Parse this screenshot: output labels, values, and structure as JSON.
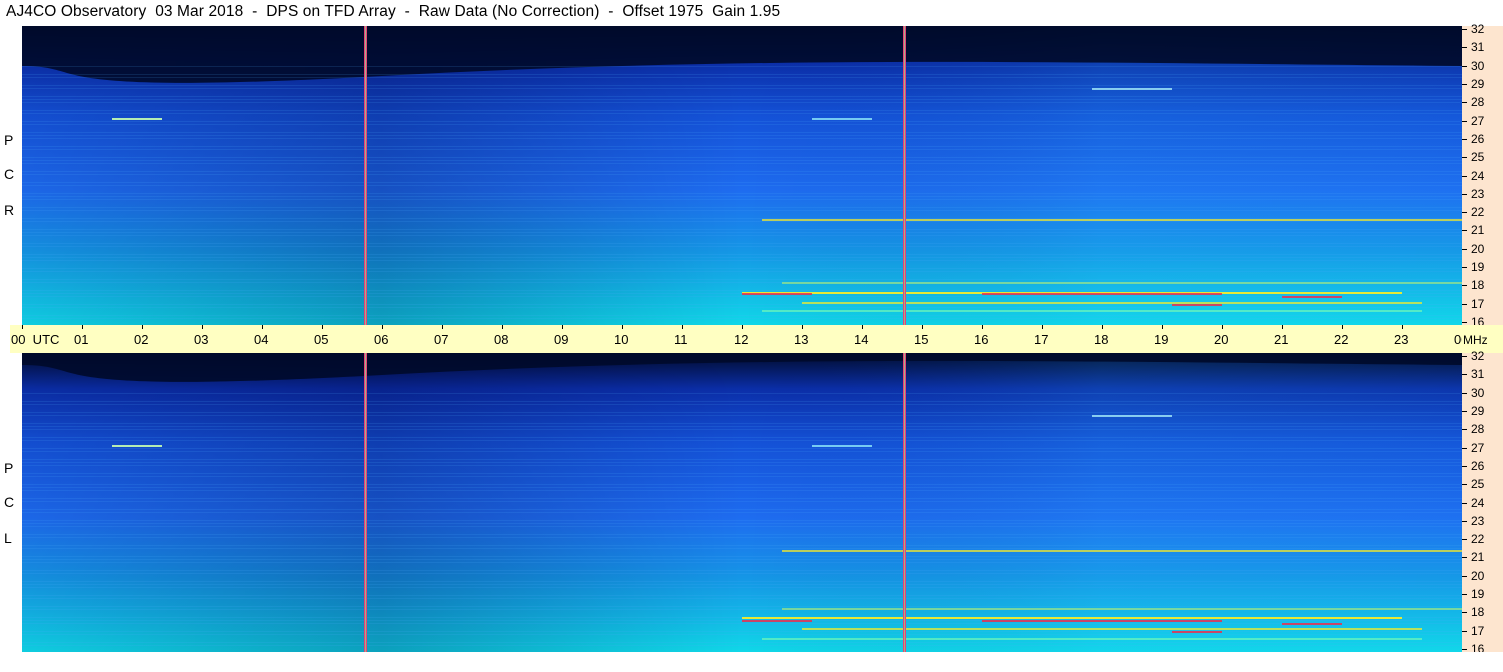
{
  "title": "AJ4CO Observatory  03 Mar 2018  -  DPS on TFD Array  -  Raw Data (No Correction)  -  Offset 1975  Gain 1.95",
  "panels": [
    {
      "id": "rcp",
      "label_letters": [
        "R",
        "C",
        "P"
      ]
    },
    {
      "id": "lcp",
      "label_letters": [
        "L",
        "C",
        "P"
      ]
    }
  ],
  "frequency_axis": {
    "labels": [
      "32",
      "31",
      "30",
      "29",
      "28",
      "27",
      "26",
      "25",
      "24",
      "23",
      "22",
      "21",
      "20",
      "19",
      "18",
      "17",
      "16"
    ],
    "unit": "MHz",
    "range": [
      16,
      32
    ]
  },
  "time_axis": {
    "first_label": "00  UTC",
    "labels": [
      "01",
      "02",
      "03",
      "04",
      "05",
      "06",
      "07",
      "08",
      "09",
      "10",
      "11",
      "12",
      "13",
      "14",
      "15",
      "16",
      "17",
      "18",
      "19",
      "20",
      "21",
      "22",
      "23",
      "00"
    ],
    "range_hours": [
      0,
      24
    ]
  },
  "colors": {
    "spectrogram_background": "#1e6cf0",
    "spectrogram_dark": "#000a2a",
    "spectrogram_bright": "#10d8e8",
    "spectrogram_hot": "#ffee22",
    "marker_lines": "#e8407a",
    "mhz_axis_bg": "#fde5cf",
    "utc_axis_bg": "#ffffc2"
  }
}
